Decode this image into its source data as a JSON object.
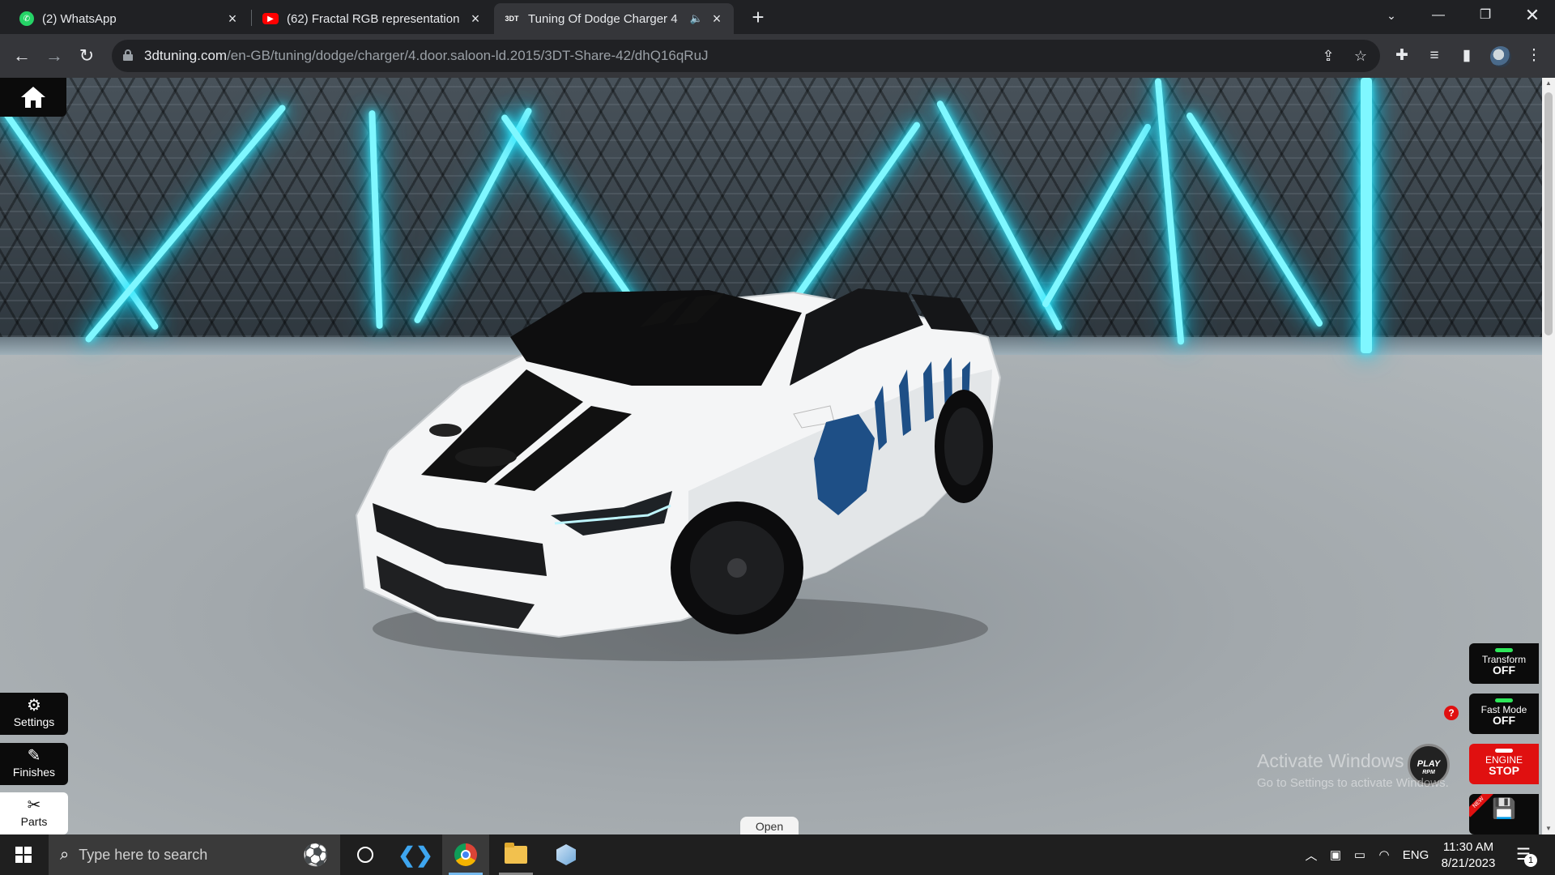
{
  "browser": {
    "tabs": [
      {
        "title": "(2) WhatsApp",
        "icon": "whatsapp-icon",
        "color": "#25d366"
      },
      {
        "title": "(62) Fractal RGB representation -",
        "icon": "youtube-icon",
        "color": "#ff0000"
      },
      {
        "title": "Tuning Of Dodge Charger 4",
        "icon": "3dtuning-icon",
        "color": "#ffffff"
      }
    ],
    "url_host": "3dtuning.com",
    "url_path": "/en-GB/tuning/dodge/charger/4.door.saloon-ld.2015/3DT-Share-42/dhQ16qRuJ"
  },
  "viewport": {
    "left_menu": {
      "settings_label": "Settings",
      "finishes_label": "Finishes",
      "parts_label": "Parts"
    },
    "right_menu": {
      "transform_label": "Transform",
      "transform_state": "OFF",
      "fastmode_label": "Fast Mode",
      "fastmode_state": "OFF",
      "engine_label": "ENGINE",
      "engine_state": "STOP",
      "help_label": "?",
      "play_label": "PLAY",
      "play_sub": "RPM",
      "save_badge": "NEW"
    },
    "open_label": "Open",
    "watermark_title": "Activate Windows",
    "watermark_sub": "Go to Settings to activate Windows."
  },
  "taskbar": {
    "search_placeholder": "Type here to search",
    "language": "ENG",
    "time": "11:30 AM",
    "date": "8/21/2023",
    "notification_count": "1"
  },
  "colors": {
    "neon": "#5ef3ff",
    "engine_red": "#e01010",
    "toggle_green": "#2ee85a"
  }
}
